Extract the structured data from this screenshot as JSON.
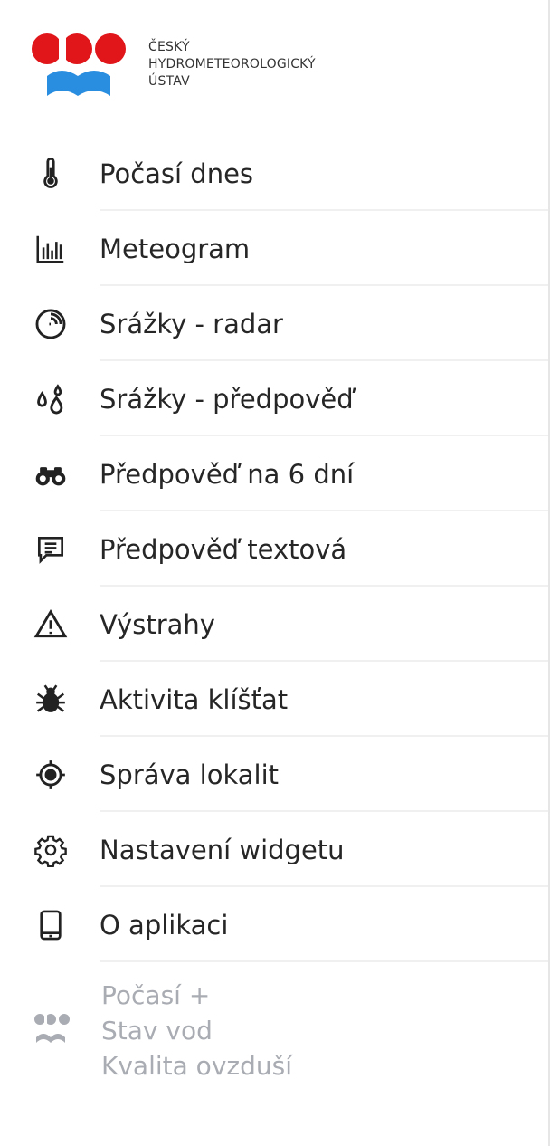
{
  "logo": {
    "lines": [
      "ČESKÝ",
      "HYDROMETEOROLOGICKÝ",
      "ÚSTAV"
    ],
    "colors": {
      "red": "#e0161b",
      "blue": "#2a8ee0"
    }
  },
  "menu": {
    "items": [
      {
        "label": "Počasí dnes",
        "icon": "thermometer-icon"
      },
      {
        "label": "Meteogram",
        "icon": "bar-chart-icon"
      },
      {
        "label": "Srážky - radar",
        "icon": "radar-icon"
      },
      {
        "label": "Srážky - předpověď",
        "icon": "raindrops-icon"
      },
      {
        "label": "Předpověď na 6 dní",
        "icon": "binoculars-icon"
      },
      {
        "label": "Předpověď textová",
        "icon": "message-icon"
      },
      {
        "label": "Výstrahy",
        "icon": "warning-icon"
      },
      {
        "label": "Aktivita klíšťat",
        "icon": "tick-icon"
      },
      {
        "label": "Správa lokalit",
        "icon": "location-target-icon"
      },
      {
        "label": "Nastavení widgetu",
        "icon": "gear-icon"
      },
      {
        "label": "O aplikaci",
        "icon": "tablet-icon"
      }
    ]
  },
  "promo": {
    "lines": [
      "Počasí +",
      "Stav vod",
      "Kvalita ovzduší"
    ],
    "icon": "chmi-mini-logo-icon",
    "color": "#a9acb2"
  }
}
